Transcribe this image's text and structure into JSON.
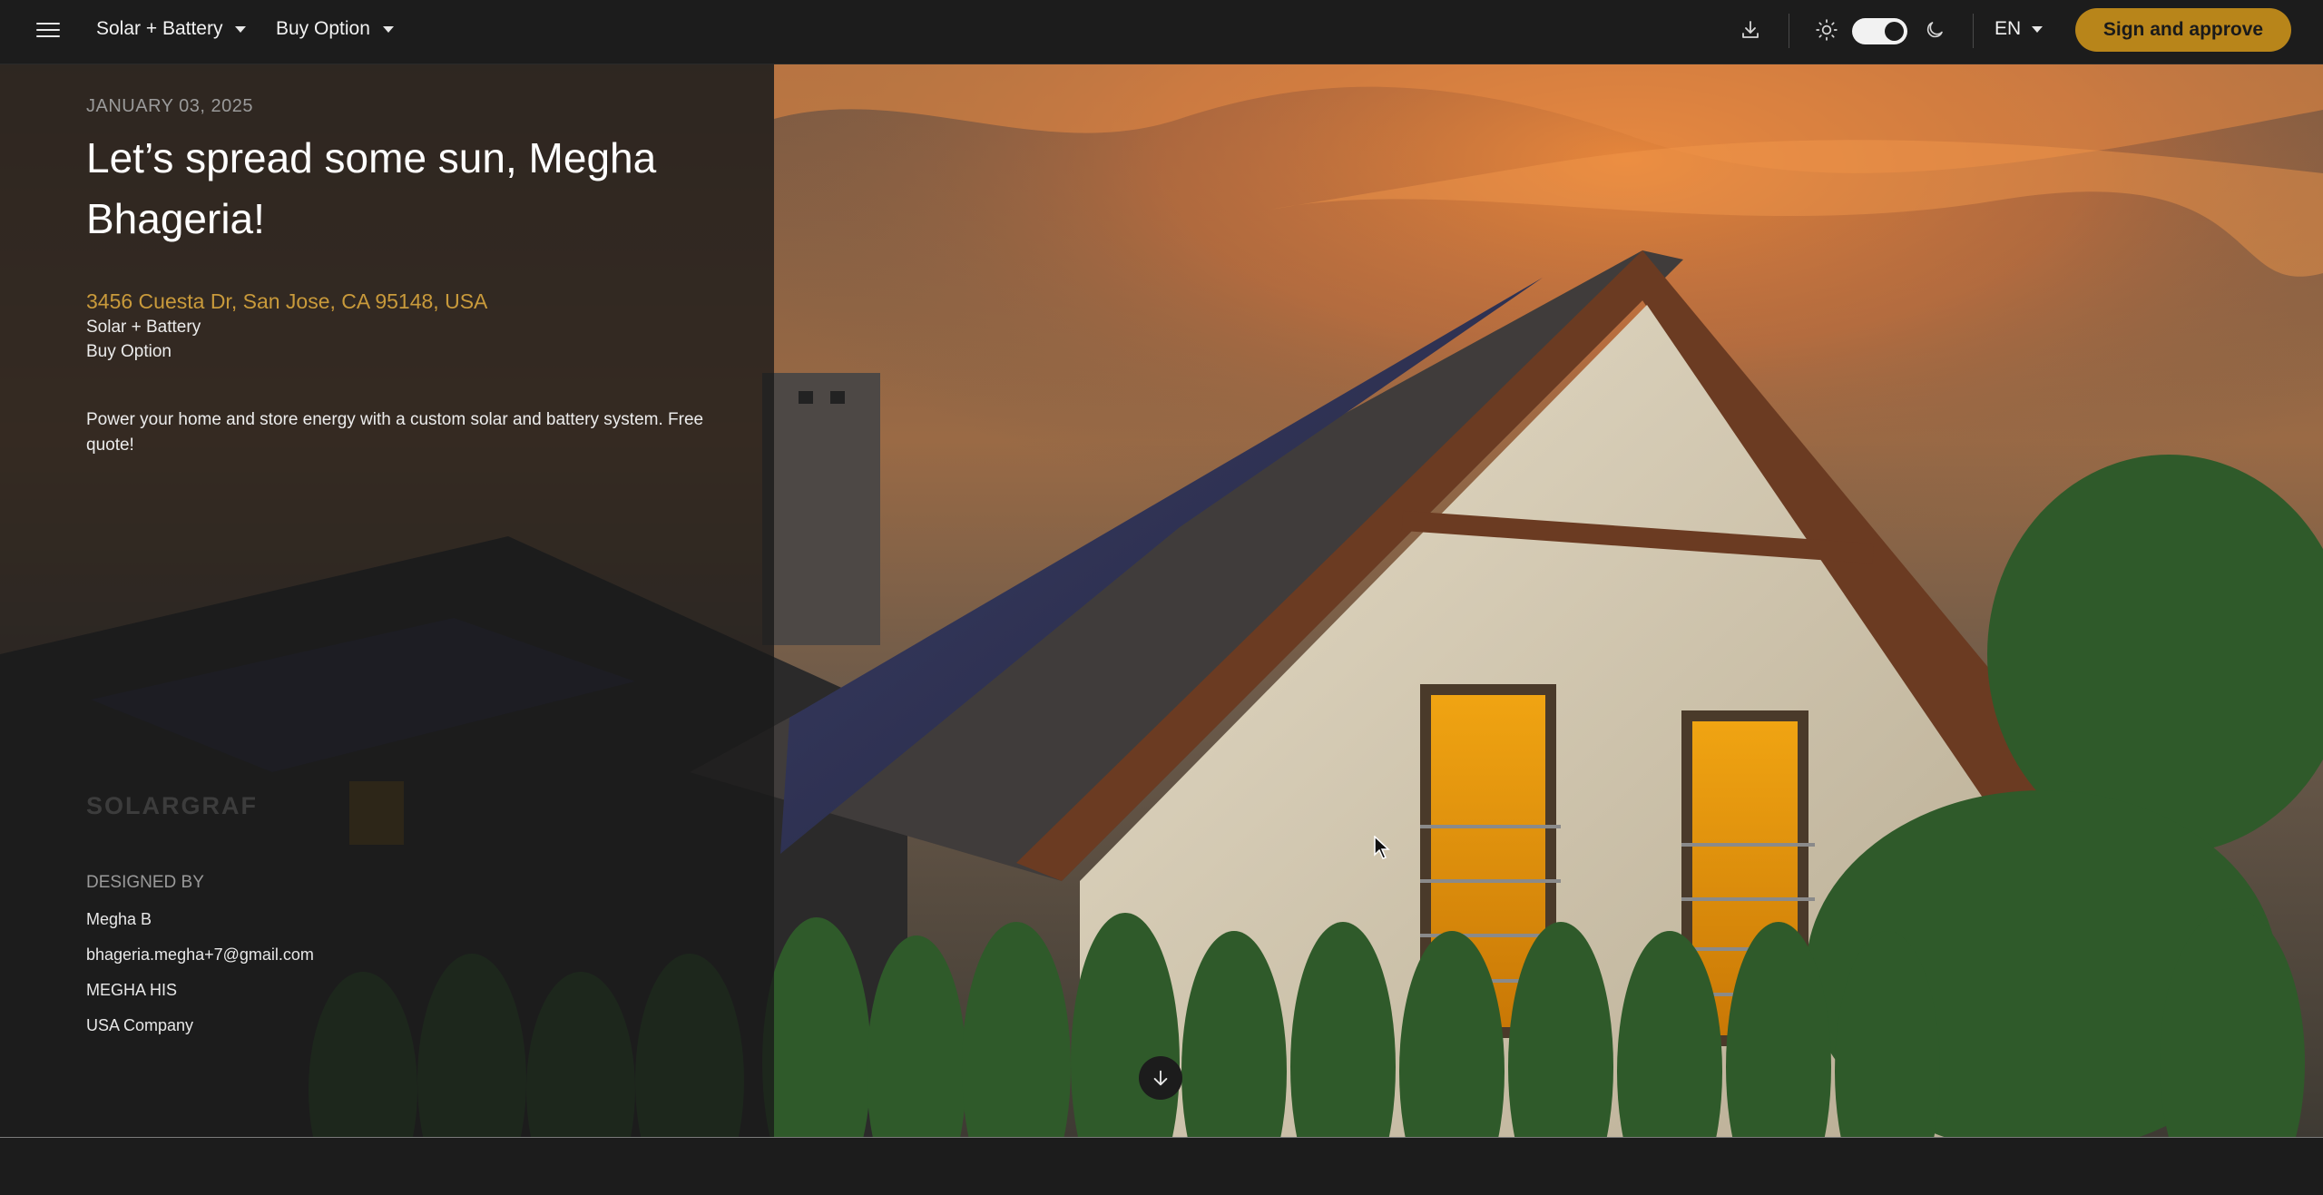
{
  "topbar": {
    "menu_icon": "hamburger-menu-icon",
    "product_dropdown": "Solar + Battery",
    "option_dropdown": "Buy Option",
    "download_icon": "download-icon",
    "light_icon": "sun-icon",
    "dark_icon": "moon-icon",
    "theme_toggle_state": "on",
    "language": "EN",
    "sign_button": "Sign and approve",
    "accent_color": "#b8851a"
  },
  "hero": {
    "date": "JANUARY 03, 2025",
    "headline": "Let’s spread some sun, Megha Bhageria!",
    "address": "3456 Cuesta Dr, San Jose, CA 95148, USA",
    "product": "Solar + Battery",
    "option": "Buy Option",
    "description": "Power your home and store energy with a custom solar and battery system. Free quote!",
    "logo": "SOLARGRAF",
    "designed_by_label": "DESIGNED BY",
    "designer_name": "Megha B",
    "designer_email": "bhageria.megha+7@gmail.com",
    "designer_company": "MEGHA HIS",
    "designer_country": "USA Company",
    "scroll_icon": "arrow-down-icon"
  }
}
